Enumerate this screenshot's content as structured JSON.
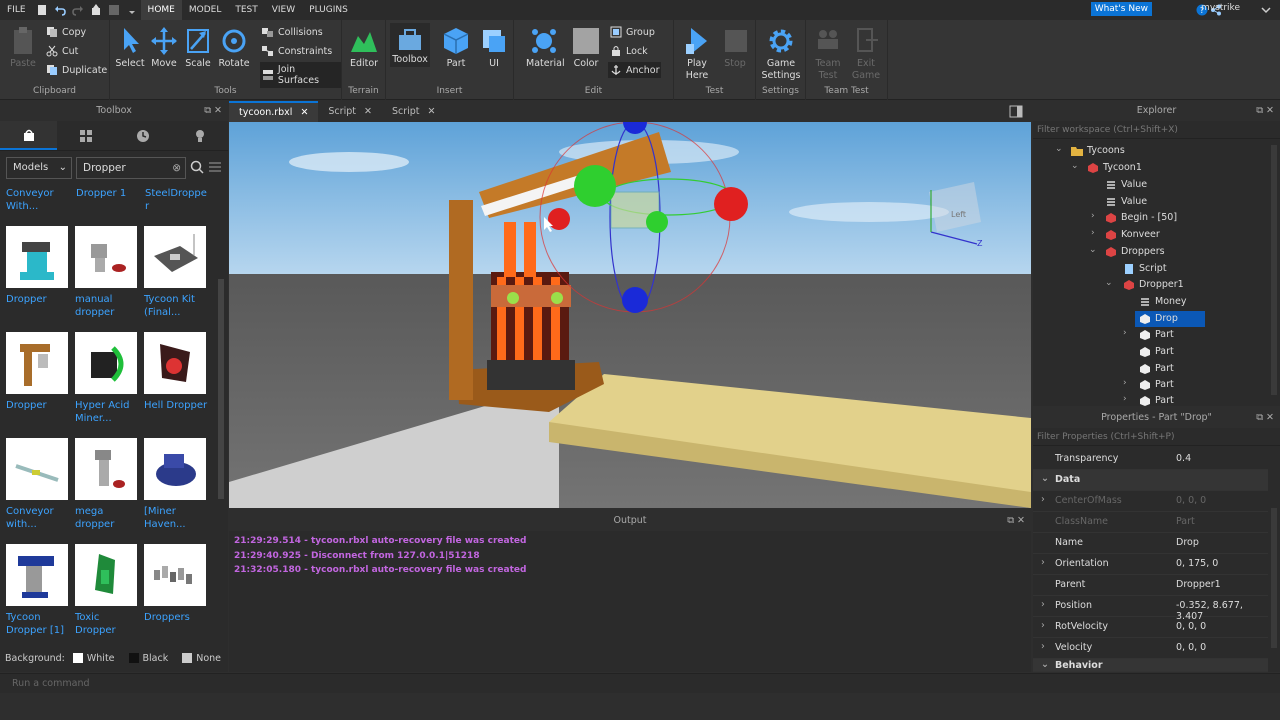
{
  "menubar": {
    "file": "FILE",
    "tabs": [
      "HOME",
      "MODEL",
      "TEST",
      "VIEW",
      "PLUGINS"
    ],
    "whats_new": "What's New",
    "username": "mvstrike"
  },
  "ribbon": {
    "clipboard": {
      "paste": "Paste",
      "copy": "Copy",
      "cut": "Cut",
      "duplicate": "Duplicate",
      "label": "Clipboard"
    },
    "tools": {
      "select": "Select",
      "move": "Move",
      "scale": "Scale",
      "rotate": "Rotate",
      "collisions": "Collisions",
      "constraints": "Constraints",
      "join_surfaces": "Join Surfaces",
      "label": "Tools"
    },
    "terrain": {
      "editor": "Editor",
      "label": "Terrain"
    },
    "insert": {
      "toolbox": "Toolbox",
      "part": "Part",
      "ui": "UI",
      "label": "Insert"
    },
    "edit": {
      "material": "Material",
      "color": "Color",
      "group": "Group",
      "lock": "Lock",
      "anchor": "Anchor",
      "label": "Edit"
    },
    "test": {
      "play_here": "Play Here",
      "stop": "Stop",
      "label": "Test"
    },
    "settings": {
      "game_settings": "Game Settings",
      "label": "Settings"
    },
    "team_test": {
      "team_test": "Team Test",
      "exit_game": "Exit Game",
      "label": "Team Test"
    }
  },
  "doc_tabs": [
    "tycoon.rbxl",
    "Script",
    "Script"
  ],
  "toolbox": {
    "title": "Toolbox",
    "category": "Models",
    "search_value": "Dropper",
    "top_row": [
      "Conveyor With...",
      "Dropper 1",
      "SteelDropper"
    ],
    "items": [
      "Dropper",
      "manual dropper",
      "Tycoon Kit (Final...",
      "Dropper",
      "Hyper Acid Miner...",
      "Hell Dropper",
      "Conveyor with...",
      "mega dropper",
      "[Miner Haven...",
      "Tycoon Dropper [1]",
      "Toxic Dropper",
      "Droppers"
    ],
    "background_label": "Background:",
    "bg_options": [
      "White",
      "Black",
      "None"
    ]
  },
  "viewport": {
    "view_cube_label": "Left"
  },
  "output": {
    "title": "Output",
    "lines": [
      "21:29:29.514 - tycoon.rbxl auto-recovery file was created",
      "21:29:40.925 - Disconnect from 127.0.0.1|51218",
      "21:32:05.180 - tycoon.rbxl auto-recovery file was created"
    ]
  },
  "explorer": {
    "title": "Explorer",
    "filter_placeholder": "Filter workspace (Ctrl+Shift+X)",
    "tree": [
      "Tycoons",
      "Tycoon1",
      "Value",
      "Value",
      "Begin - [50]",
      "Konveer",
      "Droppers",
      "Script",
      "Dropper1",
      "Money",
      "Drop",
      "Part",
      "Part",
      "Part",
      "Part",
      "Part"
    ]
  },
  "properties": {
    "title": "Properties - Part \"Drop\"",
    "filter_placeholder": "Filter Properties (Ctrl+Shift+P)",
    "rows": [
      {
        "name": "Transparency",
        "value": "0.4"
      },
      {
        "name": "Data",
        "value": ""
      },
      {
        "name": "CenterOfMass",
        "value": "0, 0, 0"
      },
      {
        "name": "ClassName",
        "value": "Part"
      },
      {
        "name": "Name",
        "value": "Drop"
      },
      {
        "name": "Orientation",
        "value": "0, 175, 0"
      },
      {
        "name": "Parent",
        "value": "Dropper1"
      },
      {
        "name": "Position",
        "value": "-0.352, 8.677, 3.407"
      },
      {
        "name": "RotVelocity",
        "value": "0, 0, 0"
      },
      {
        "name": "Velocity",
        "value": "0, 0, 0"
      },
      {
        "name": "Behavior",
        "value": ""
      }
    ]
  },
  "command_bar": {
    "placeholder": "Run a command"
  }
}
